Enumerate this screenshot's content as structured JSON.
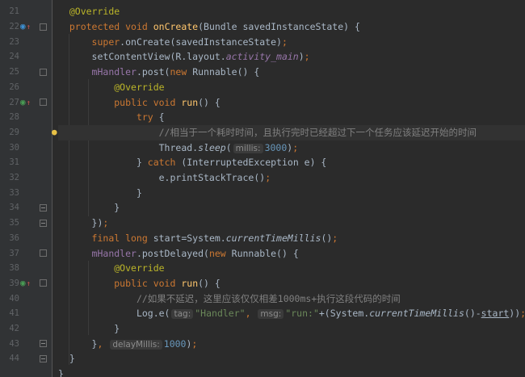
{
  "editor": {
    "line_numbers": [
      "21",
      "22",
      "23",
      "24",
      "25",
      "26",
      "27",
      "28",
      "29",
      "30",
      "31",
      "32",
      "33",
      "34",
      "35",
      "36",
      "37",
      "38",
      "39",
      "40",
      "41",
      "42",
      "43",
      "44"
    ],
    "highlighted_line": "29",
    "gutter_icons": [
      {
        "line": "22",
        "icon": "override-method-icon",
        "arrow": "navigate-up-arrow-icon"
      },
      {
        "line": "27",
        "icon": "implement-method-icon",
        "arrow": "navigate-up-arrow-icon"
      },
      {
        "line": "39",
        "icon": "implement-method-icon",
        "arrow": "navigate-up-arrow-icon"
      },
      {
        "line": "29",
        "icon": "intention-bulb-icon"
      }
    ],
    "colors": {
      "background": "#2b2b2b",
      "gutter": "#313335",
      "keyword": "#cc7832",
      "annotation": "#bbb529",
      "method_decl": "#ffc66d",
      "field": "#9876aa",
      "string": "#6a8759",
      "number": "#6897bb",
      "comment": "#808080",
      "plain": "#a9b7c6",
      "hint_bg": "#3b3b3b"
    }
  },
  "code": {
    "l21": {
      "ann": "@Override"
    },
    "l22": {
      "mod": "protected void ",
      "name": "onCreate",
      "args": "(Bundle savedInstanceState) {"
    },
    "l23": {
      "sup": "super",
      "rest": ".onCreate(savedInstanceState)",
      "semi": ";"
    },
    "l24": {
      "a": "setContentView(R.layout.",
      "b": "activity_main",
      "c": ")",
      "semi": ";"
    },
    "l25": {
      "a": "mHandler",
      "b": ".post(",
      "kw": "new ",
      "c": "Runnable() {"
    },
    "l26": {
      "ann": "@Override"
    },
    "l27": {
      "mod": "public void ",
      "name": "run",
      "rest": "() {"
    },
    "l28": {
      "kw": "try ",
      "rest": "{"
    },
    "l29": {
      "comment": "//相当于一个耗时时间，且执行完时已经超过下一个任务应该延迟开始的时间"
    },
    "l30": {
      "a": "Thread.",
      "b": "sleep",
      "c": "(",
      "hint": "millis:",
      "num": "3000",
      "d": ")",
      "semi": ";"
    },
    "l31": {
      "a": "} ",
      "kw": "catch ",
      "b": "(InterruptedException e) {"
    },
    "l32": {
      "a": "e.printStackTrace()",
      "semi": ";"
    },
    "l33": {
      "a": "}"
    },
    "l34": {
      "a": "}"
    },
    "l35": {
      "a": "})",
      "semi": ";"
    },
    "l36": {
      "kw": "final long ",
      "a": "start=System.",
      "b": "currentTimeMillis",
      "c": "()",
      "semi": ";"
    },
    "l37": {
      "a": "mHandler",
      "b": ".postDelayed(",
      "kw": "new ",
      "c": "Runnable() {"
    },
    "l38": {
      "ann": "@Override"
    },
    "l39": {
      "mod": "public void ",
      "name": "run",
      "rest": "() {"
    },
    "l40": {
      "comment": "//如果不延迟，这里应该仅仅相差1000ms+执行这段代码的时间"
    },
    "l41": {
      "a": "Log.e(",
      "hint1": "tag:",
      "str1": "\"Handler\"",
      "comma": ", ",
      "hint2": "msg:",
      "str2": "\"run:\"",
      "b": "+(System.",
      "c": "currentTimeMillis",
      "d": "()-",
      "e": "start",
      "f": "))",
      "semi": ";"
    },
    "l42": {
      "a": "}"
    },
    "l43": {
      "a": "}",
      "comma": ", ",
      "hint": "delayMillis:",
      "num": "1000",
      "b": ")",
      "semi": ";"
    },
    "l44": {
      "a": "}"
    },
    "l45": {
      "a": "}"
    }
  }
}
